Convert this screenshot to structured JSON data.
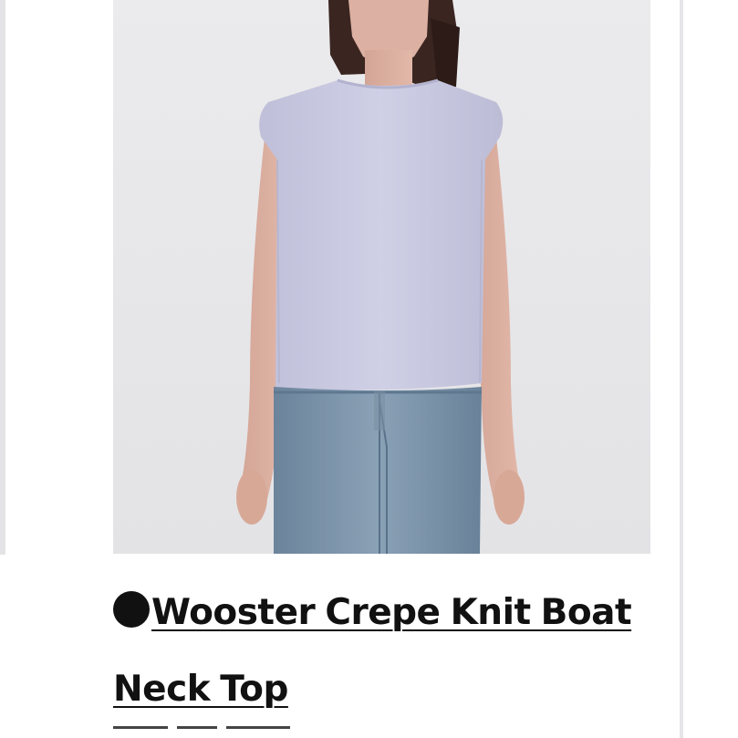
{
  "product": {
    "image_alt": "Model wearing lavender sleeveless boat neck knit top with blue jeans",
    "title": "Wooster Crepe Knit Boat Neck Top",
    "bullet_icon": "black-circle-bullet"
  },
  "colors": {
    "photo_background": "#e9e9eb",
    "top_color": "#c9c9e2",
    "denim_color": "#7d95ab",
    "text": "#111111"
  }
}
